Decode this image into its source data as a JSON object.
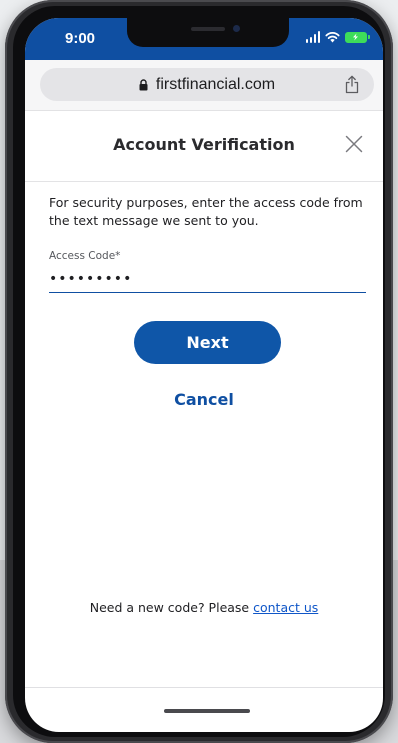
{
  "status_bar": {
    "time": "9:00",
    "icons": [
      "signal-icon",
      "wifi-icon",
      "battery-charging-icon"
    ]
  },
  "browser": {
    "url": "firstfinancial.com",
    "lock_icon": "lock-icon",
    "share_icon": "share-icon"
  },
  "modal": {
    "title": "Account Verification",
    "close_icon": "close-icon"
  },
  "form": {
    "instructions": "For security purposes, enter the access code from the text message we sent to you.",
    "access_code_label": "Access Code*",
    "access_code_value": "•••••••••",
    "next_label": "Next",
    "cancel_label": "Cancel"
  },
  "footer": {
    "prompt": "Need a new code? Please ",
    "link_label": "contact us"
  },
  "colors": {
    "brand_blue": "#0f4fa2",
    "button_blue": "#0f56a8",
    "battery_green": "#3ddc5a"
  }
}
